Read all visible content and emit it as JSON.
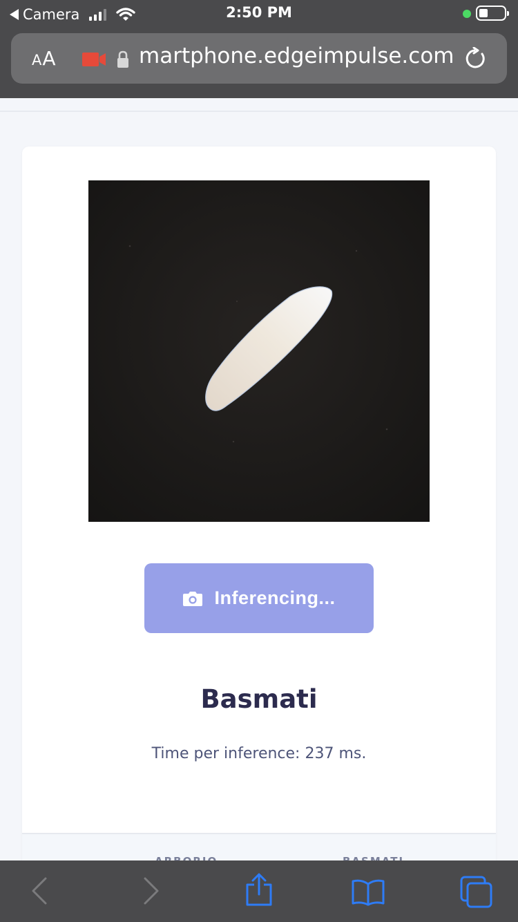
{
  "status_bar": {
    "back_app": "Camera",
    "time": "2:50 PM"
  },
  "url_bar": {
    "text_size_label": "AA",
    "url": "martphone.edgeimpulse.com"
  },
  "card": {
    "button_label": "Inferencing...",
    "result_label": "Basmati",
    "time_per_inference": "Time per inference: 237 ms.",
    "table_headers": [
      "ARBORIO",
      "BASMATI"
    ]
  },
  "icons": {
    "back": "back-chevron-icon",
    "forward": "forward-chevron-icon",
    "share": "share-icon",
    "bookmarks": "book-icon",
    "tabs": "tabs-icon",
    "camera_button": "camera-icon"
  },
  "colors": {
    "button": "#97a0e8",
    "title": "#2c2b4e",
    "recording": "#e64a3a",
    "toolbar_active": "#2e7cf6"
  }
}
